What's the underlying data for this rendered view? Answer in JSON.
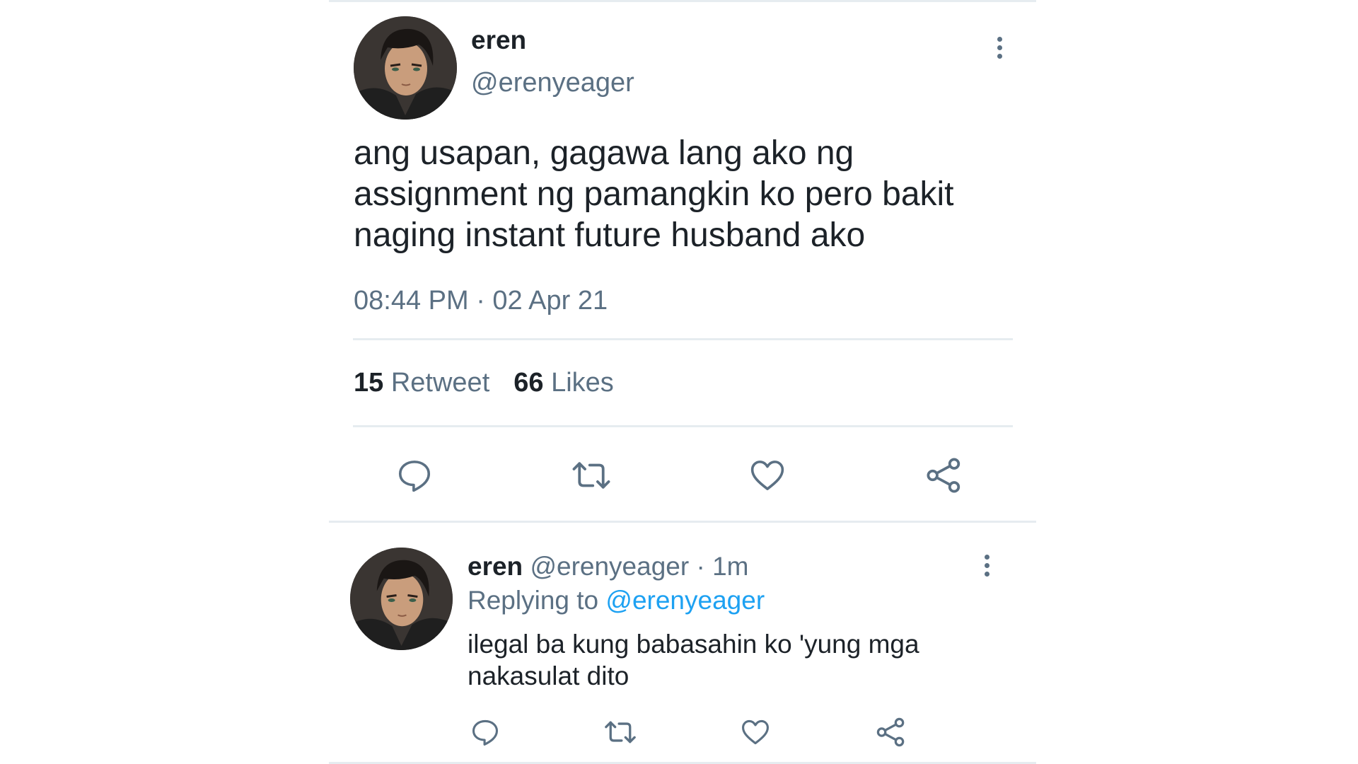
{
  "tweet": {
    "author_name": "eren",
    "author_handle": "@erenyeager",
    "text": "ang usapan, gagawa lang ako ng assignment ng pamangkin ko pero bakit naging instant future husband ako",
    "timestamp": "08:44 PM · 02 Apr 21",
    "retweet_count": "15",
    "retweet_label": "Retweet",
    "likes_count": "66",
    "likes_label": "Likes",
    "actions": [
      "comment-icon",
      "retweet-icon",
      "heart-icon",
      "share-icon"
    ]
  },
  "reply": {
    "author_name": "eren",
    "author_handle": "@erenyeager",
    "time": "· 1m",
    "replying_label": "Replying to",
    "replying_to": "@erenyeager",
    "text": "ilegal ba kung babasahin ko 'yung mga nakasulat dito",
    "actions": [
      "comment-icon",
      "retweet-icon",
      "heart-icon",
      "share-icon"
    ]
  },
  "colors": {
    "text_primary": "#1c2228",
    "text_secondary": "#5b7083",
    "link": "#1da1f2",
    "divider": "#e6ecf0"
  }
}
